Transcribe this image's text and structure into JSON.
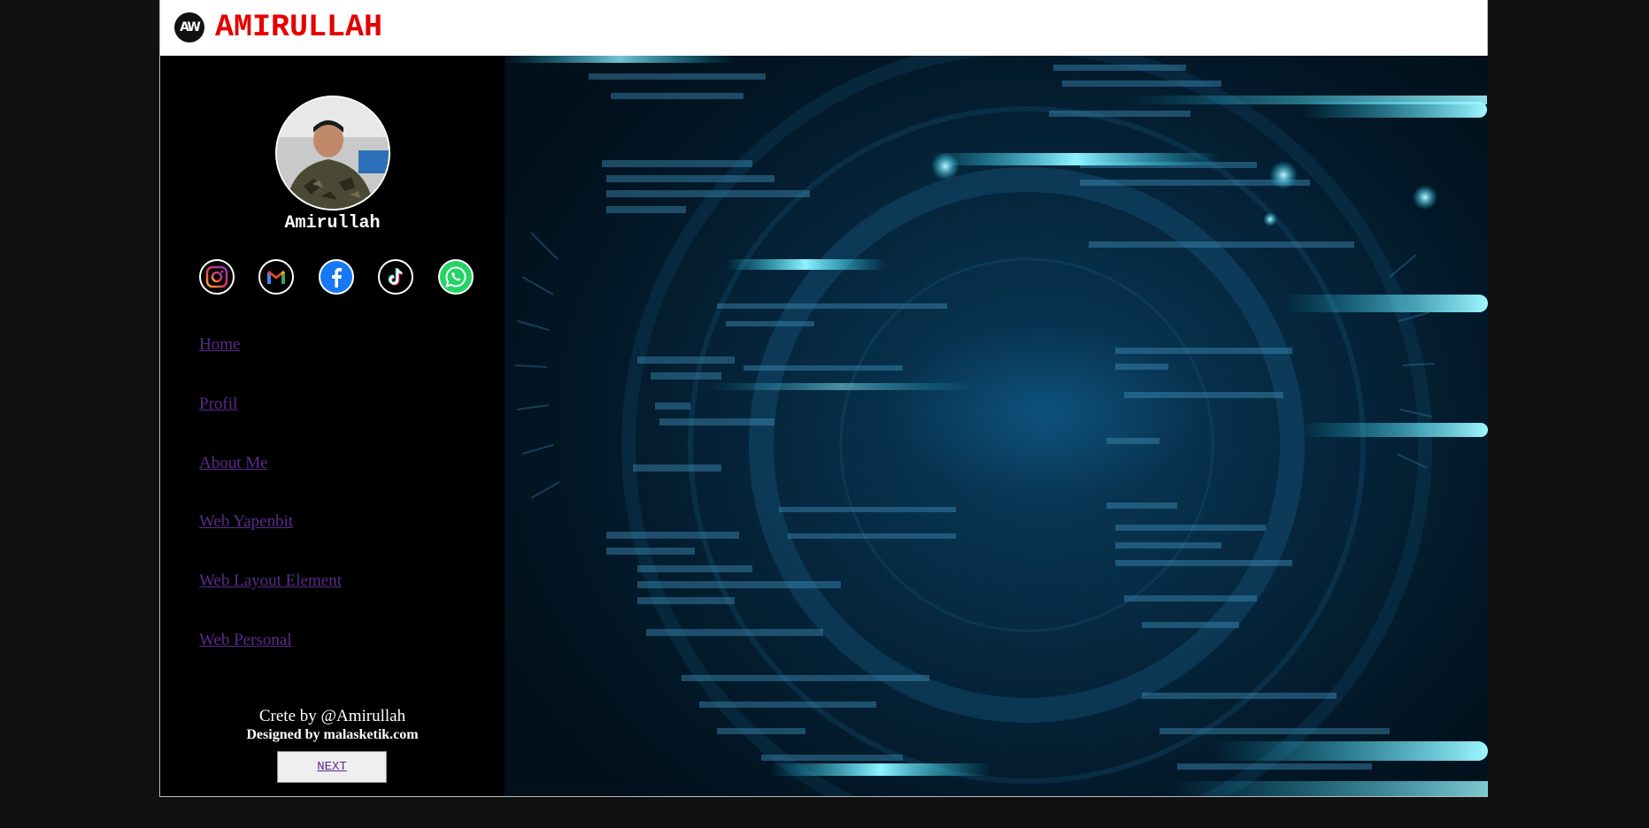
{
  "header": {
    "logo_text": "AW",
    "title": "AMIRULLAH"
  },
  "profile": {
    "name": "Amirullah"
  },
  "social": [
    {
      "icon": "instagram-icon"
    },
    {
      "icon": "gmail-icon"
    },
    {
      "icon": "facebook-icon"
    },
    {
      "icon": "tiktok-icon"
    },
    {
      "icon": "whatsapp-icon"
    }
  ],
  "nav": {
    "items": [
      {
        "label": "Home"
      },
      {
        "label": "Profil"
      },
      {
        "label": "About Me"
      },
      {
        "label": "Web Yapenbit"
      },
      {
        "label": "Web Layout Element"
      },
      {
        "label": "Web Personal"
      }
    ]
  },
  "footer": {
    "credit": "Crete by @Amirullah",
    "designed": "Designed by malasketik.com",
    "next_label": "NEXT"
  },
  "colors": {
    "page_bg": "#111111",
    "title_red": "#e50000",
    "link_purple": "#5b2a8c",
    "hero_cyan": "#19d7ff"
  }
}
